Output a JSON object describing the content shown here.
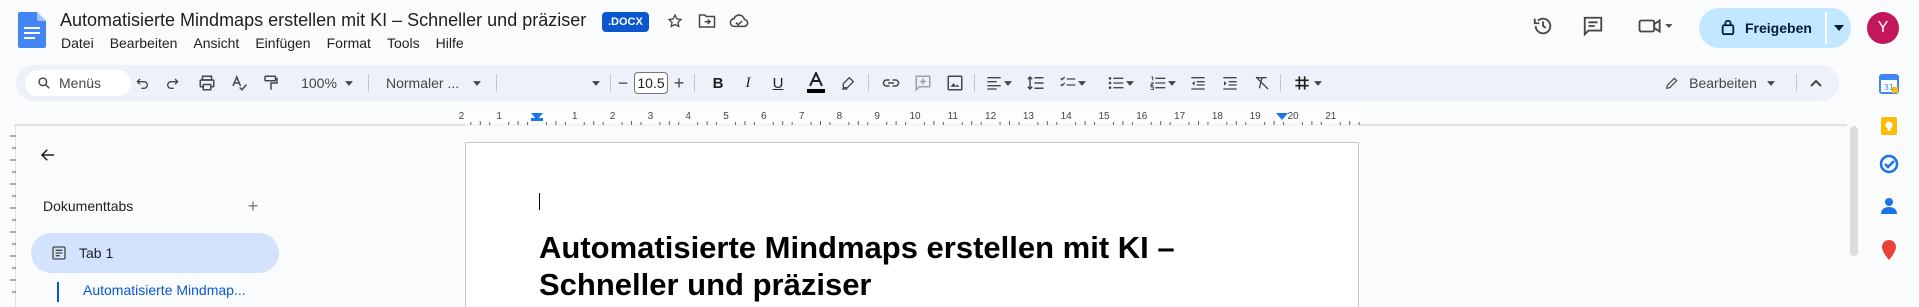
{
  "document": {
    "title": "Automatisierte Mindmaps erstellen mit KI – Schneller und präziser",
    "format_badge": ".DOCX"
  },
  "menu": [
    "Datei",
    "Bearbeiten",
    "Ansicht",
    "Einfügen",
    "Format",
    "Tools",
    "Hilfe"
  ],
  "header_actions": {
    "share_label": "Freigeben",
    "avatar_initial": "Y"
  },
  "toolbar": {
    "search_label": "Menüs",
    "zoom": "100%",
    "style": "Normaler ...",
    "font": "",
    "font_size": "10.5",
    "mode_label": "Bearbeiten"
  },
  "ruler": {
    "labels": [
      "2",
      "1",
      "1",
      "2",
      "3",
      "4",
      "5",
      "6",
      "7",
      "8",
      "9",
      "10",
      "11",
      "12",
      "13",
      "14",
      "15",
      "16",
      "17",
      "18",
      "19",
      "20",
      "21"
    ]
  },
  "tabs_panel": {
    "heading": "Dokumenttabs",
    "tab_label": "Tab 1",
    "outline_item": "Automatisierte Mindmap..."
  },
  "page": {
    "heading": "Automatisierte Mindmaps erstellen mit KI – Schneller und präziser"
  },
  "colors": {
    "accent": "#0b57d0",
    "share_bg": "#c2e7ff",
    "avatar_bg": "#c2185b",
    "toolbar_bg": "#edf2fa",
    "tab_selected_bg": "#d3e3fd"
  }
}
